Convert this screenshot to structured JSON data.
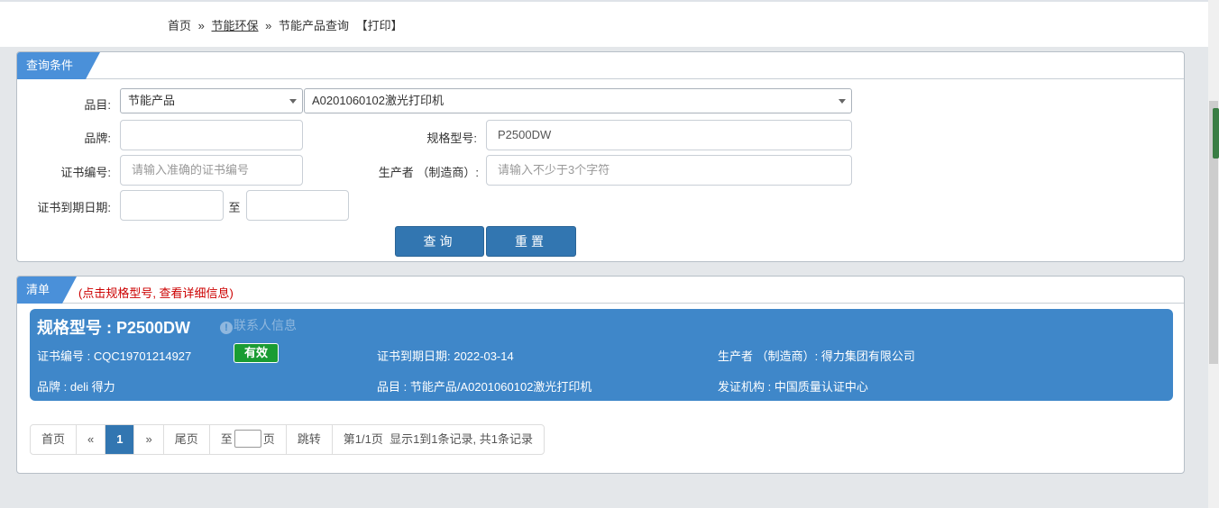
{
  "breadcrumb": {
    "home": "首页",
    "sep1": "»",
    "category": "节能环保",
    "sep2": "»",
    "current": "节能产品查询",
    "print": "【打印】"
  },
  "query_panel": {
    "tab_label": "查询条件",
    "category_label": "品目:",
    "category_select1": "节能产品",
    "category_select2": "A0201060102激光打印机",
    "brand_label": "品牌:",
    "brand_value": "",
    "model_label": "规格型号:",
    "model_value": "P2500DW",
    "cert_no_label": "证书编号:",
    "cert_no_placeholder": "请输入准确的证书编号",
    "maker_label": "生产者 （制造商）:",
    "maker_placeholder": "请输入不少于3个字符",
    "expiry_label": "证书到期日期:",
    "expiry_to": "至",
    "search_button": "查询",
    "reset_button": "重置"
  },
  "list_panel": {
    "tab_label": "清单",
    "hint": "(点击规格型号, 查看详细信息)",
    "result": {
      "title": "规格型号 : P2500DW",
      "contact": "联系人信息",
      "contact_icon": "info-icon",
      "cert_no": "证书编号 : CQC19701214927",
      "status": "有效",
      "expiry": "证书到期日期: 2022-03-14",
      "maker": "生产者 （制造商）: 得力集团有限公司",
      "brand": "品牌 : deli 得力",
      "category": "品目 : 节能产品/A0201060102激光打印机",
      "issuer": "发证机构 : 中国质量认证中心"
    },
    "pager": {
      "first": "首页",
      "prev": "«",
      "page": "1",
      "next": "»",
      "last": "尾页",
      "goto_prefix": "至",
      "goto_suffix": "页",
      "jump": "跳转",
      "info": "第1/1页  显示1到1条记录, 共1条记录"
    }
  },
  "colors": {
    "accent": "#3276b1",
    "card": "#3f87c9",
    "tab": "#4a90d9",
    "badge": "#1a9c33",
    "hint": "#cc0000"
  }
}
